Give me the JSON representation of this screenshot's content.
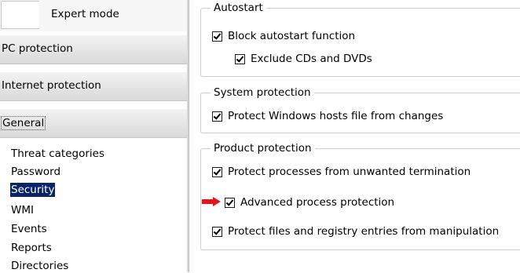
{
  "nav": {
    "expert_mode_label": "Expert mode",
    "sections": [
      {
        "label": "PC protection"
      },
      {
        "label": "Internet protection"
      },
      {
        "label": "General"
      }
    ],
    "general_items": [
      {
        "label": "Threat categories"
      },
      {
        "label": "Password"
      },
      {
        "label": "Security",
        "selected": true
      },
      {
        "label": "WMI"
      },
      {
        "label": "Events"
      },
      {
        "label": "Reports"
      },
      {
        "label": "Directories"
      }
    ]
  },
  "groups": {
    "autostart": {
      "title": "Autostart",
      "block_autostart": {
        "label": "Block autostart function",
        "checked": true
      },
      "exclude_cds": {
        "label": "Exclude CDs and DVDs",
        "checked": true
      }
    },
    "system_protection": {
      "title": "System protection",
      "protect_hosts": {
        "label": "Protect Windows hosts file from changes",
        "checked": true
      }
    },
    "product_protection": {
      "title": "Product protection",
      "protect_processes": {
        "label": "Protect processes from unwanted termination",
        "checked": true
      },
      "advanced_process": {
        "label": "Advanced process protection",
        "checked": true
      },
      "protect_files": {
        "label": "Protect files and registry entries from manipulation",
        "checked": true
      }
    }
  },
  "annotation": {
    "arrow_color": "#e8141b",
    "arrow_icon": "right-arrow-icon"
  }
}
